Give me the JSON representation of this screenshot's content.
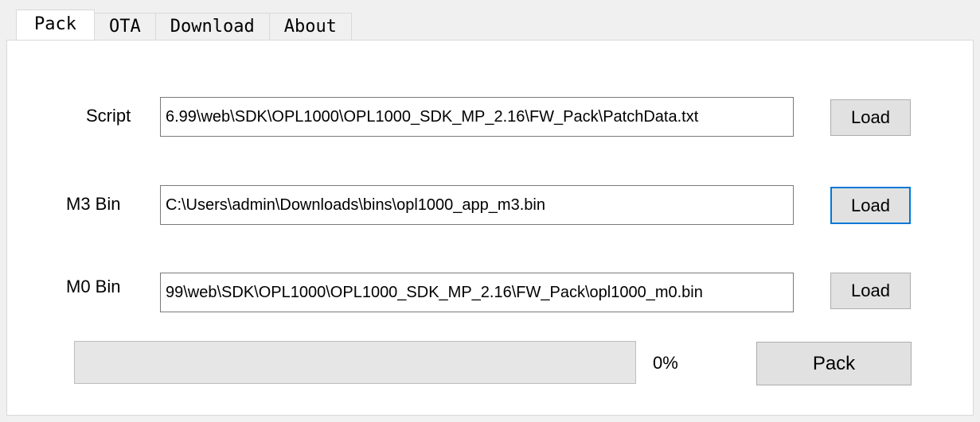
{
  "tabs": [
    {
      "label": "Pack",
      "active": true
    },
    {
      "label": "OTA",
      "active": false
    },
    {
      "label": "Download",
      "active": false
    },
    {
      "label": "About",
      "active": false
    }
  ],
  "form": {
    "script": {
      "label": "Script",
      "value": "6.99\\web\\SDK\\OPL1000\\OPL1000_SDK_MP_2.16\\FW_Pack\\PatchData.txt",
      "button": "Load"
    },
    "m3": {
      "label": "M3 Bin",
      "value": "C:\\Users\\admin\\Downloads\\bins\\opl1000_app_m3.bin",
      "button": "Load"
    },
    "m0": {
      "label": "M0 Bin",
      "value": "99\\web\\SDK\\OPL1000\\OPL1000_SDK_MP_2.16\\FW_Pack\\opl1000_m0.bin",
      "button": "Load"
    }
  },
  "progress": {
    "value": 0,
    "text": "0%"
  },
  "pack_button": "Pack",
  "colors": {
    "focus_border": "#0078d7",
    "button_bg": "#e1e1e1",
    "progress_fill": "#06b025"
  }
}
